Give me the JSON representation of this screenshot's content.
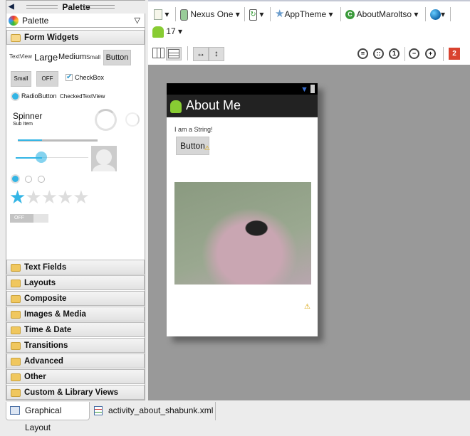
{
  "palette": {
    "title": "Palette",
    "selector": "Palette",
    "open_category": "Form Widgets",
    "widgets": {
      "textview": "TextView",
      "large": "Large",
      "medium": "Medium",
      "small": "Small",
      "button": "Button",
      "small_button": "Small",
      "toggle": "OFF",
      "checkbox": "CheckBox",
      "radio": "RadioButton",
      "checked_text": "CheckedTextView",
      "spinner": "Spinner",
      "sub_item": "Sub Item",
      "switch": "OFF",
      "rating": 1,
      "rating_max": 5
    },
    "categories": [
      "Text Fields",
      "Layouts",
      "Composite",
      "Images & Media",
      "Time & Date",
      "Transitions",
      "Advanced",
      "Other",
      "Custom & Library Views"
    ]
  },
  "toolbar": {
    "device": "Nexus One",
    "theme": "AppTheme",
    "activity": "AboutMaroltso",
    "api": "17",
    "error_count": "2"
  },
  "preview": {
    "title": "About Me",
    "text": "I am a String!",
    "button": "Button"
  },
  "tabs": [
    {
      "label": "Graphical Layout",
      "active": true
    },
    {
      "label": "activity_about_shabunk.xml",
      "active": false
    }
  ],
  "colors": {
    "accent": "#33b5e5",
    "error": "#d9432f",
    "canvas": "#999999",
    "actionbar": "#222222"
  }
}
